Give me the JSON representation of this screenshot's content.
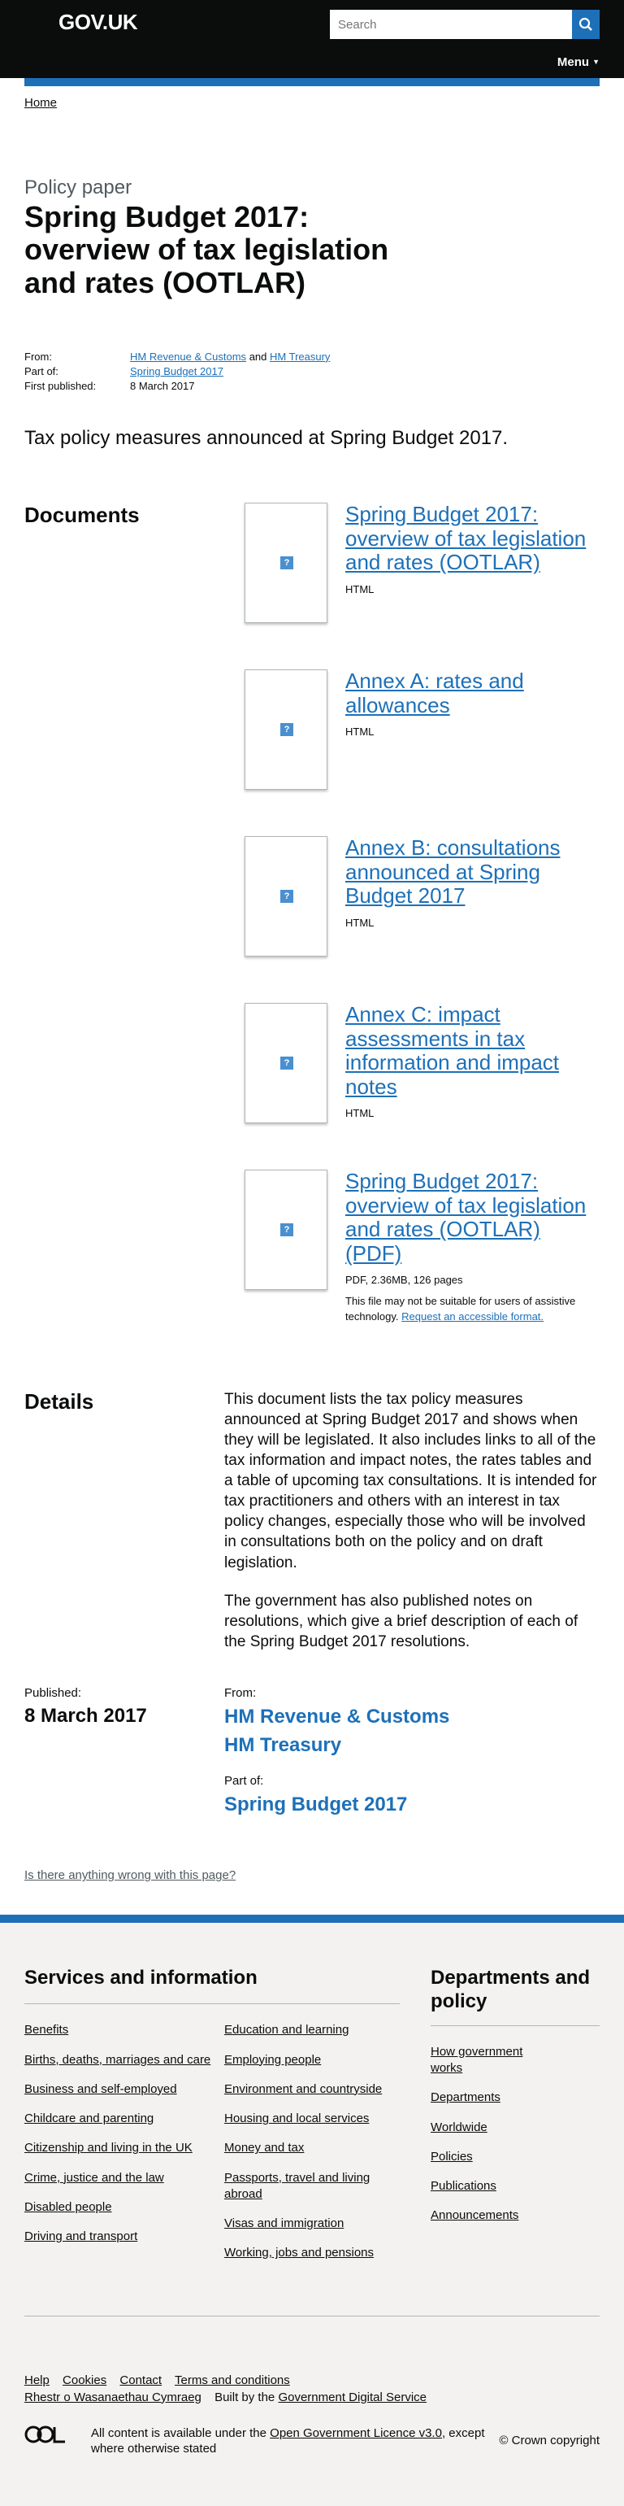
{
  "header": {
    "logo": "GOV.UK",
    "search_placeholder": "Search",
    "menu_label": "Menu"
  },
  "breadcrumb": {
    "home": "Home"
  },
  "page": {
    "caption": "Policy paper",
    "title": "Spring Budget 2017: overview of tax legislation and rates (OOTLAR)",
    "from_label": "From:",
    "from_orgs": [
      "HM Revenue & Customs",
      "HM Treasury"
    ],
    "from_and": "and",
    "part_of_label": "Part of:",
    "part_of": "Spring Budget 2017",
    "first_published_label": "First published:",
    "first_published": "8 March 2017",
    "lede": "Tax policy measures announced at Spring Budget 2017."
  },
  "documents": {
    "heading": "Documents",
    "items": [
      {
        "title": "Spring Budget 2017: overview of tax legislation and rates (OOTLAR)",
        "meta": "HTML"
      },
      {
        "title": "Annex A: rates and allowances",
        "meta": "HTML"
      },
      {
        "title": "Annex B: consultations announced at Spring Budget 2017",
        "meta": "HTML"
      },
      {
        "title": "Annex C: impact assessments in tax information and impact notes",
        "meta": "HTML"
      },
      {
        "title": "Spring Budget 2017: overview of tax legislation and rates (OOTLAR) (PDF)",
        "meta": "PDF, 2.36MB, 126 pages",
        "note": "This file may not be suitable for users of assistive technology.",
        "note_link": "Request an accessible format."
      }
    ],
    "thumb_icon": "?"
  },
  "details": {
    "heading": "Details",
    "paragraphs": [
      "This document lists the tax policy measures announced at Spring Budget 2017 and shows when they will be legislated. It also includes links to all of the tax information and impact notes, the rates tables and a table of upcoming tax consultations. It is intended for tax practitioners and others with an interest in tax policy changes, especially those who will be involved in consultations both on the policy and on draft legislation.",
      "The government has also published notes on resolutions, which give a brief description of each of the Spring Budget 2017 resolutions."
    ]
  },
  "published": {
    "label": "Published:",
    "date": "8 March 2017",
    "from_label": "From:",
    "orgs": [
      "HM Revenue & Customs",
      "HM Treasury"
    ],
    "part_of_label": "Part of:",
    "part_of": "Spring Budget 2017"
  },
  "feedback_link": "Is there anything wrong with this page?",
  "footer": {
    "services_heading": "Services and information",
    "services_col1": [
      "Benefits",
      "Births, deaths, marriages and care",
      "Business and self-employed",
      "Childcare and parenting",
      "Citizenship and living in the UK",
      "Crime, justice and the law",
      "Disabled people",
      "Driving and transport"
    ],
    "services_col2": [
      "Education and learning",
      "Employing people",
      "Environment and countryside",
      "Housing and local services",
      "Money and tax",
      "Passports, travel and living abroad",
      "Visas and immigration",
      "Working, jobs and pensions"
    ],
    "departments_heading": "Departments and policy",
    "departments": [
      "How government works",
      "Departments",
      "Worldwide",
      "Policies",
      "Publications",
      "Announcements"
    ],
    "meta_links": [
      "Help",
      "Cookies",
      "Contact",
      "Terms and conditions"
    ],
    "welsh": "Rhestr o Wasanaethau Cymraeg",
    "built_by": "Built by the",
    "gds": "Government Digital Service",
    "licence_pre": "All content is available under the",
    "licence_link": "Open Government Licence v3.0",
    "licence_post": ", except where otherwise stated",
    "copyright": "© Crown copyright"
  },
  "colors": {
    "brand_blue": "#1d70b8",
    "header_black": "#0b0c0c",
    "footer_bg": "#f3f2f1"
  }
}
